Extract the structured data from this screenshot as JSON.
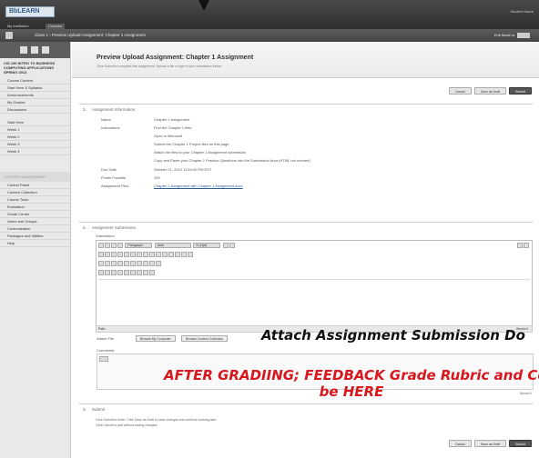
{
  "app": {
    "logo": "BbLEARN",
    "tabs": [
      "My Institution",
      "Courses"
    ],
    "user_menu": "Student Name"
  },
  "breadcrumb": {
    "path": "Class 1  ›  Preview Upload Assignment: Chapter 1 Assignment",
    "edit_mode": "Edit Mode is:"
  },
  "sidebar": {
    "course_title": "CIS 105 INTRO TO BUSINESS COMPUTING APPLICATIONS SPRING 2013",
    "items_top": [
      "Course Content",
      "Start Here & Syllabus",
      "Announcements",
      "My Grades",
      "Discussions"
    ],
    "items_weeks": [
      "Start Here",
      "Week 1",
      "Week 2",
      "Week 3",
      "Week 4"
    ],
    "management_header": "COURSE MANAGEMENT",
    "items_mgmt": [
      "Control Panel",
      "Content Collection",
      "Course Tools",
      "Evaluation",
      "Grade Center",
      "Users and Groups",
      "Customization",
      "Packages and Utilities",
      "Help"
    ]
  },
  "page": {
    "title": "Preview Upload Assignment: Chapter 1 Assignment",
    "subtitle": "Click Submit to complete this assignment. Upload a file or type in your submission below."
  },
  "buttons": {
    "cancel": "Cancel",
    "save_draft": "Save as Draft",
    "submit": "Submit"
  },
  "section1": {
    "number": "1.",
    "title": "Assignment Information",
    "rows": [
      {
        "label": "Name",
        "value": "Chapter 1 Assignment"
      },
      {
        "label": "Instructions",
        "value": "Find the Chapter 1 files"
      },
      {
        "label": "",
        "value": "Open in Microsoft"
      },
      {
        "label": "",
        "value": "Submit the Chapter 1 Project files on this page"
      },
      {
        "label": "",
        "value": "Attach the files to your Chapter 1 Assignment submission"
      },
      {
        "label": "",
        "value": "Copy and Paste your Chapter 1 Practice Questions into the Submission Area (HTML not needed)"
      },
      {
        "label": "Due Date",
        "value": "October 21, 2013 11:59:00 PM EST"
      },
      {
        "label": "Points Possible",
        "value": "100"
      },
      {
        "label": "Assignment Files",
        "value": "Chapter 1 Assignment with Chapter 1 Assignment.docx"
      }
    ]
  },
  "section2": {
    "number": "2.",
    "title": "Assignment Submission",
    "submission_label": "Submission",
    "toolbar": {
      "format": "Paragraph",
      "font": "Arial",
      "size": "3 (12pt)"
    },
    "path_label": "Path:",
    "words_label": "Words:0",
    "attach_label": "Attach File",
    "browse_computer": "Browse My Computer",
    "browse_collection": "Browse Content Collection",
    "comments_label": "Comments",
    "comments_words": "Words:0"
  },
  "annotations": {
    "attach": "Attach Assignment Submission Do",
    "grade_line1": "AFTER GRADIING;  FEEDBACK  Grade Rubric and Co",
    "grade_line2": "be HERE"
  },
  "section3": {
    "number": "3.",
    "title": "Submit",
    "text_lines": [
      "Click Submit to finish. Click Save as Draft to save changes and continue working later.",
      "Click Cancel to quit without saving changes."
    ]
  }
}
